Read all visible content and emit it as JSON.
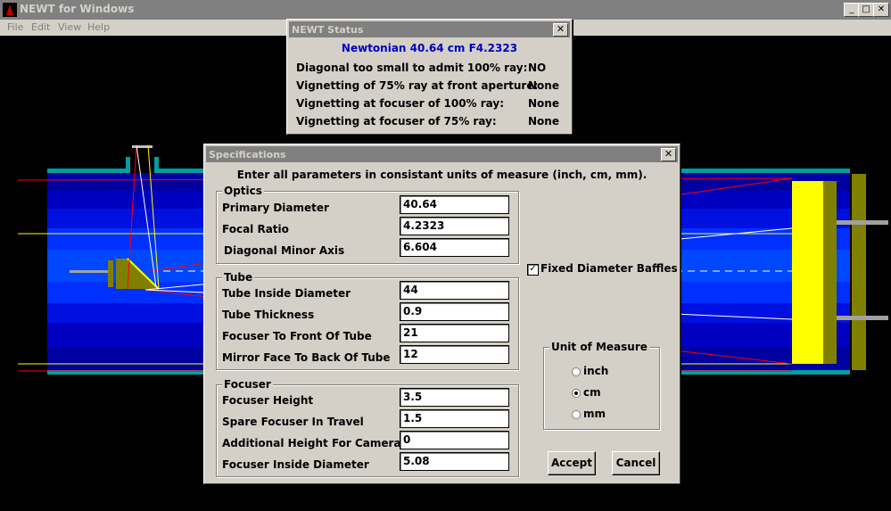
{
  "window": {
    "title": "NEWT for Windows",
    "minimize_glyph": "_",
    "maximize_glyph": "□",
    "close_glyph": "✕"
  },
  "menu": [
    "File",
    "Edit",
    "View",
    "Help"
  ],
  "status_dialog": {
    "title": "NEWT Status",
    "close_glyph": "✕",
    "headline": "Newtonian 40.64 cm F4.2323",
    "rows": [
      {
        "label": "Diagonal too small to admit 100% ray:",
        "value": "NO"
      },
      {
        "label": "Vignetting of 75% ray at front aperture:",
        "value": "None"
      },
      {
        "label": "Vignetting at focuser of 100% ray:",
        "value": "None"
      },
      {
        "label": "Vignetting at focuser of 75% ray:",
        "value": "None"
      }
    ]
  },
  "spec_dialog": {
    "title": "Specifications",
    "close_glyph": "✕",
    "instruction": "Enter all parameters in consistant units of measure (inch, cm, mm).",
    "optics": {
      "label": "Optics",
      "fields": [
        {
          "label": "Primary Diameter",
          "value": "40.64"
        },
        {
          "label": "Focal Ratio",
          "value": "4.2323"
        },
        {
          "label": "Diagonal Minor Axis",
          "value": "6.604"
        }
      ]
    },
    "tube": {
      "label": "Tube",
      "fields": [
        {
          "label": "Tube Inside Diameter",
          "value": "44"
        },
        {
          "label": "Tube Thickness",
          "value": "0.9"
        },
        {
          "label": "Focuser To Front Of Tube",
          "value": "21"
        },
        {
          "label": "Mirror Face To Back Of Tube",
          "value": "12"
        }
      ]
    },
    "focuser": {
      "label": "Focuser",
      "fields": [
        {
          "label": "Focuser Height",
          "value": "3.5"
        },
        {
          "label": "Spare Focuser In Travel",
          "value": "1.5"
        },
        {
          "label": "Additional Height For Camera",
          "value": "0"
        },
        {
          "label": "Focuser Inside Diameter",
          "value": "5.08"
        }
      ]
    },
    "fixed_baffles": {
      "label": "Fixed Diameter Baffles",
      "checked": true,
      "check_glyph": "✓"
    },
    "units": {
      "label": "Unit of Measure",
      "options": [
        "inch",
        "cm",
        "mm"
      ],
      "selected": "cm"
    },
    "accept_label": "Accept",
    "cancel_label": "Cancel"
  },
  "colors": {
    "tube_dark": "#0000b0",
    "tube_light": "#0040ff",
    "tube_rim": "#00a0a0",
    "mirror": "#ffff00",
    "mirror_cell": "#808000",
    "ray_red": "#ff0000",
    "ray_yellow": "#ffff00"
  }
}
